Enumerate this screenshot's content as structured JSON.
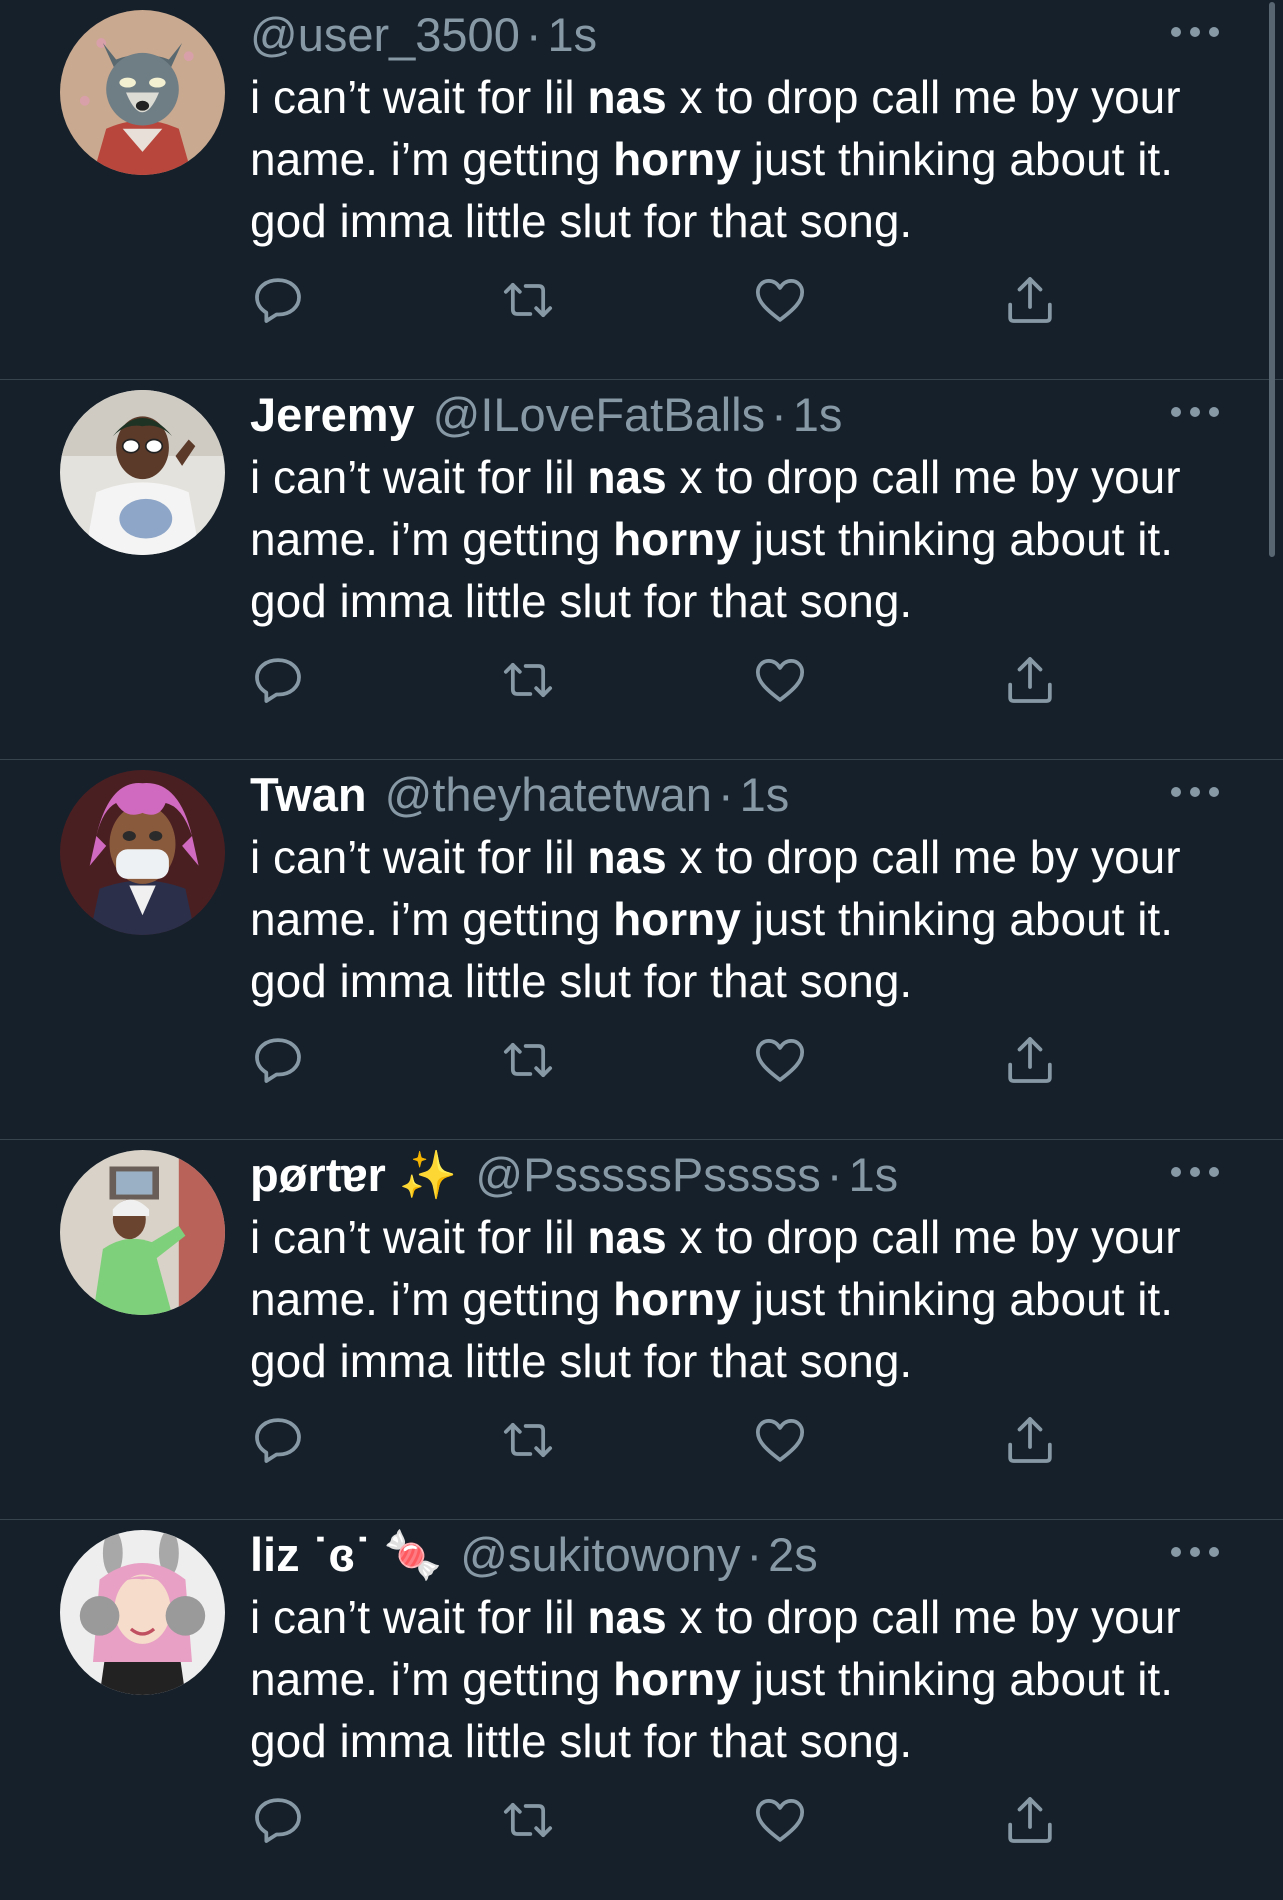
{
  "tweets": [
    {
      "display_name": "",
      "handle": "@user_3500",
      "time": "1s",
      "text": {
        "p1": "i can’t wait for lil ",
        "b1": "nas",
        "p2": " x to drop call me by your name. i’m getting ",
        "b2": "horny",
        "p3": " just thinking about it. god imma little slut for that song."
      }
    },
    {
      "display_name": "Jeremy",
      "handle": "@ILoveFatBalls",
      "time": "1s",
      "text": {
        "p1": "i can’t wait for lil ",
        "b1": "nas",
        "p2": " x to drop call me by your name. i’m getting ",
        "b2": "horny",
        "p3": " just thinking about it. god imma little slut for that song."
      }
    },
    {
      "display_name": "Twan",
      "handle": "@theyhatetwan",
      "time": "1s",
      "text": {
        "p1": "i can’t wait for lil ",
        "b1": "nas",
        "p2": " x to drop call me by your name. i’m getting ",
        "b2": "horny",
        "p3": " just thinking about it. god imma little slut for that song."
      }
    },
    {
      "display_name": "pørtɐr ✨",
      "handle": "@PsssssPsssss",
      "time": "1s",
      "text": {
        "p1": "i can’t wait for lil ",
        "b1": "nas",
        "p2": " x to drop call me by your name. i’m getting ",
        "b2": "horny",
        "p3": " just thinking about it. god imma little slut for that song."
      }
    },
    {
      "display_name": "liz ˙ɞ˙ 🍬",
      "handle": "@sukitowony",
      "time": "2s",
      "text": {
        "p1": "i can’t wait for lil ",
        "b1": "nas",
        "p2": " x to drop call me by your name. i’m getting ",
        "b2": "horny",
        "p3": " just thinking about it. god imma little slut for that song."
      }
    }
  ],
  "separator": "·",
  "icons": {
    "reply": "reply-icon",
    "retweet": "retweet-icon",
    "like": "like-icon",
    "share": "share-icon",
    "more": "more-icon"
  },
  "colors": {
    "background": "#15202b",
    "divider": "#38444d",
    "secondary_text": "#8899a6",
    "primary_text": "#ffffff"
  }
}
